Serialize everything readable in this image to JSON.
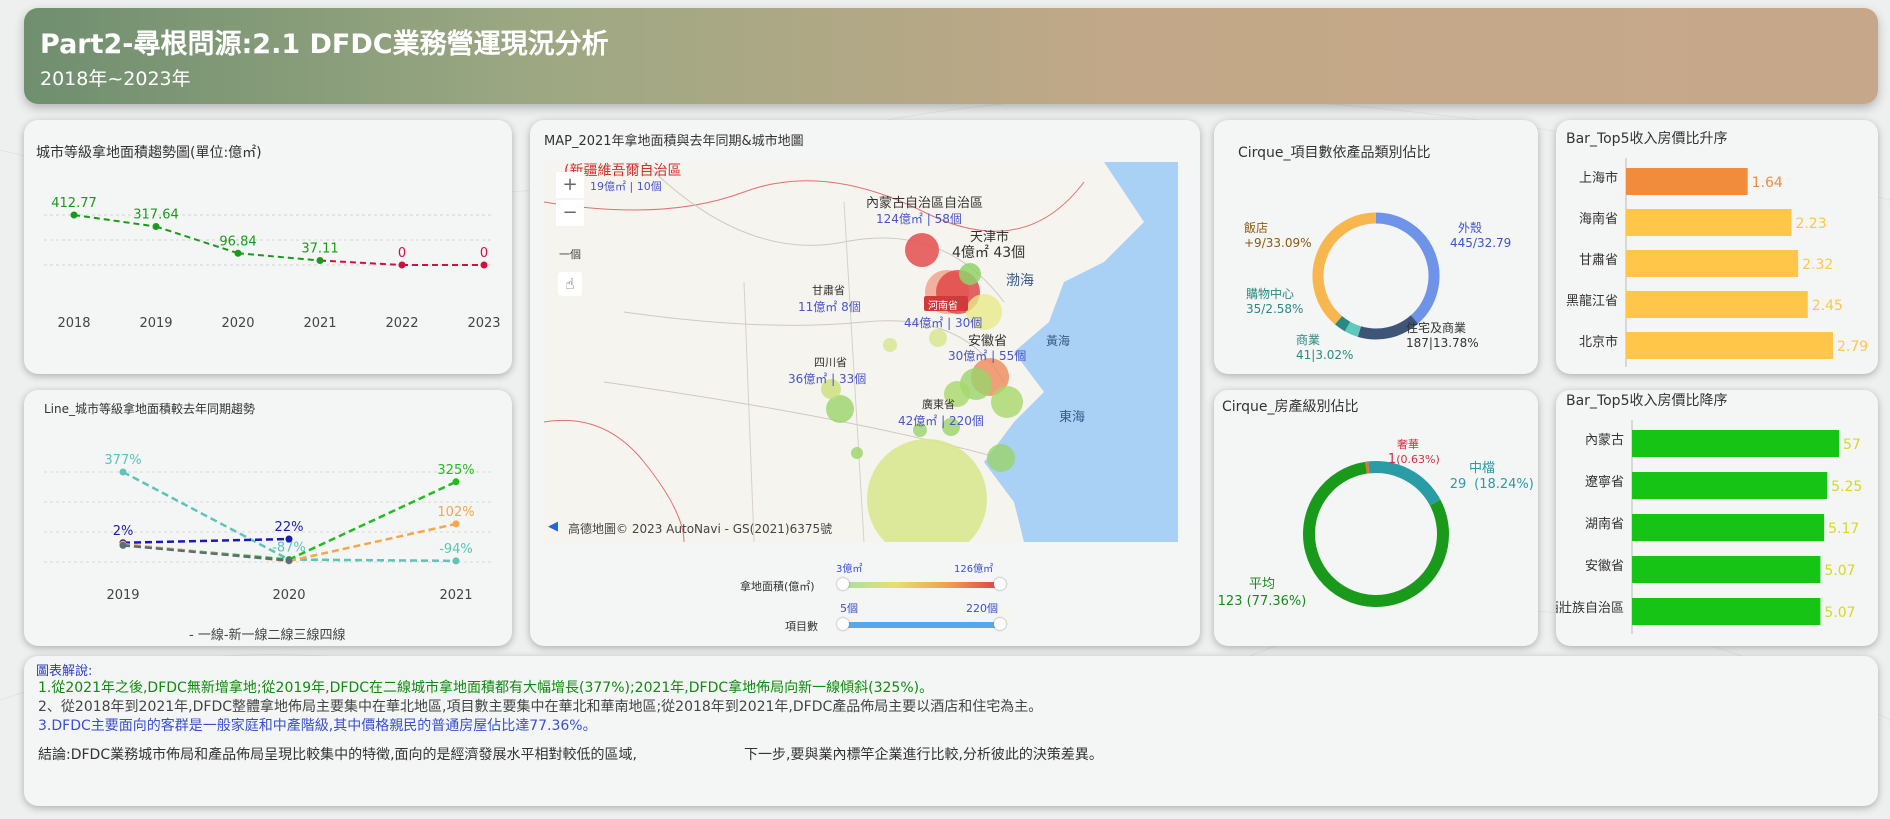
{
  "header": {
    "title": "Part2-尋根問源:2.1 DFDC業務營運現況分析",
    "subtitle": "2018年~2023年"
  },
  "trend_card": {
    "title": "城市等級拿地面積趨勢圖(單位:億㎡)",
    "chart_data": {
      "type": "line",
      "x": [
        "2018",
        "2019",
        "2020",
        "2021",
        "2022",
        "2023"
      ],
      "series": [
        {
          "values": [
            412.77,
            317.64,
            96.84,
            37.11,
            0,
            0
          ]
        }
      ],
      "value_labels": [
        "412.77",
        "317.64",
        "96.84",
        "37.11",
        "0",
        "0"
      ],
      "colors": {
        "green": "#1a9a1a",
        "red": "#d01040"
      }
    }
  },
  "yoy_card": {
    "title": "Line_城市等級拿地面積較去年同期趨勢",
    "legend": "- 一線-新一線二線三線四線",
    "chart_data": {
      "type": "line",
      "x": [
        "2019",
        "2020",
        "2021"
      ],
      "series": [
        {
          "color": "#5cc4b8",
          "values": [
            377,
            -87,
            -94
          ],
          "labels": [
            "377%",
            "-87%",
            "-94%"
          ]
        },
        {
          "color": "#1b1bb0",
          "values": [
            2,
            22,
            null
          ],
          "labels": [
            "2%",
            "22%",
            ""
          ]
        },
        {
          "color": "#22bb22",
          "values": [
            -10,
            -87,
            325
          ],
          "labels": [
            "",
            "",
            "325%"
          ]
        },
        {
          "color": "#f5a84a",
          "values": [
            -5,
            -95,
            102
          ],
          "labels": [
            "",
            "",
            "102%"
          ]
        },
        {
          "color": "#55707a",
          "values": [
            -12,
            -92,
            null
          ],
          "labels": [
            "",
            "",
            ""
          ]
        }
      ]
    }
  },
  "map_card": {
    "title": "MAP_2021年拿地面積與去年同期&城市地圖",
    "controls": {
      "zoom_in": "+",
      "zoom_out": "−",
      "single": "一個"
    },
    "attribution": "高德地圖© 2023 AutoNavi - GS(2021)6375號",
    "seas": [
      "渤海",
      "黃海",
      "東海"
    ],
    "regions": [
      {
        "name": "(新疆維吾爾自治區",
        "value": "19億㎡ | 10個",
        "color": "#d03030"
      },
      {
        "name": "內蒙古自治區自治區",
        "value": "124億㎡ | 58個"
      },
      {
        "name": "天津市",
        "value": "4億㎡ 43個"
      },
      {
        "name": "甘肅省",
        "value": "11億㎡ 8個"
      },
      {
        "name": "河南省",
        "value": "44億㎡ | 30個"
      },
      {
        "name": "安徽省",
        "value": "30億㎡ | 55個"
      },
      {
        "name": "四川省",
        "value": "36億㎡ | 33個"
      },
      {
        "name": "廣東省",
        "value": "42億㎡ | 220個"
      }
    ],
    "legend": {
      "area_label": "拿地面積(億㎡)",
      "area_min": "3億㎡",
      "area_max": "126億㎡",
      "count_label": "項目數",
      "count_min": "5個",
      "count_max": "220個"
    }
  },
  "category_card": {
    "title": "Cirque_項目數依產品類別佔比",
    "chart_data": {
      "type": "pie",
      "slices": [
        {
          "name": "外殼",
          "value": 445,
          "label": "445/32.79",
          "color": "#6f93e8"
        },
        {
          "name": "住宅及商業",
          "value": 187,
          "label": "187|13.78%",
          "color": "#3f5578"
        },
        {
          "name": "商業",
          "value": 41,
          "label": "41|3.02%",
          "color": "#5fc9bd"
        },
        {
          "name": "購物中心",
          "value": 35,
          "label": "35/2.58%",
          "color": "#2a8a82"
        },
        {
          "name": "飯店",
          "value": 449,
          "label": "+9/33.09%",
          "color": "#f7b74e"
        }
      ]
    }
  },
  "level_card": {
    "title": "Cirque_房產級別佔比",
    "chart_data": {
      "type": "pie",
      "slices": [
        {
          "name": "奢華",
          "value": 1,
          "label": "1",
          "pct": "(0.63%)",
          "color": "#e6722a"
        },
        {
          "name": "中檔",
          "value": 29,
          "label": "29",
          "pct": "(18.24%)",
          "color": "#2a9ca5"
        },
        {
          "name": "平均",
          "value": 123,
          "label": "123 (77.36%)",
          "color": "#1a9a1a"
        }
      ]
    }
  },
  "asc_card": {
    "title": "Bar_Top5收入房價比升序",
    "chart_data": {
      "type": "bar",
      "categories": [
        "上海市",
        "海南省",
        "甘肅省",
        "黑龍江省",
        "北京市"
      ],
      "values": [
        1.64,
        2.23,
        2.32,
        2.45,
        2.79
      ],
      "labels": [
        "1.64",
        "2.23",
        "2.32",
        "2.45",
        "2.79"
      ],
      "colors": [
        "#f08c3c",
        "#ffc64a",
        "#ffc64a",
        "#ffc64a",
        "#ffc64a"
      ]
    }
  },
  "desc_card": {
    "title": "Bar_Top5收入房價比降序",
    "chart_data": {
      "type": "bar",
      "categories": [
        "內蒙古",
        "遼寧省",
        "湖南省",
        "安徽省",
        "廣西壯族自治區"
      ],
      "values": [
        5.57,
        5.25,
        5.17,
        5.07,
        5.07
      ],
      "labels": [
        "57",
        "5.25",
        "5.17",
        "5.07",
        "5.07"
      ],
      "color": "#16c416"
    }
  },
  "notes": {
    "heading": "圖表解說:",
    "line1": "1.從2021年之後,DFDC無新增拿地;從2019年,DFDC在二線城市拿地面積都有大幅增長(377%);2021年,DFDC拿地佈局向新一線傾斜(325%)。",
    "line2": "2、從2018年到2021年,DFDC整體拿地佈局主要集中在華北地區,項目數主要集中在華北和華南地區;從2018年到2021年,DFDC產品佈局主要以酒店和住宅為主。",
    "line3": "3.DFDC主要面向的客群是一般家庭和中產階級,其中價格親民的普通房屋佔比達77.36%。",
    "conclusion": "結論:DFDC業務城市佈局和產品佈局呈現比較集中的特徵,面向的是經濟發展水平相對較低的區域,",
    "next_step": "下一步,要與業內標竿企業進行比較,分析彼此的決策差異。",
    "colors": {
      "heading": "#2a3fc0",
      "line1": "#108a10",
      "line2": "#444444",
      "line3": "#3a4fd0"
    }
  }
}
